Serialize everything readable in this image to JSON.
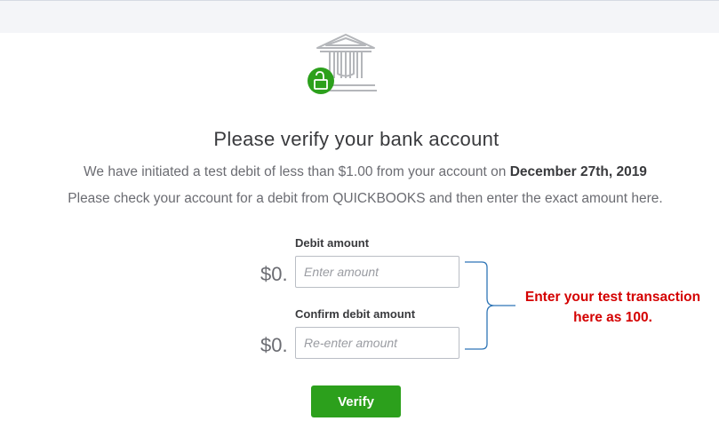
{
  "header": {
    "title": "Please verify your bank account",
    "line1_prefix": "We have initiated a test debit of less than $1.00 from your account on",
    "line1_date": "December 27th, 2019",
    "line2": "Please check your account for a debit from QUICKBOOKS and then enter the exact amount here."
  },
  "form": {
    "debit": {
      "label": "Debit amount",
      "prefix": "$0.",
      "value": "",
      "placeholder": "Enter amount"
    },
    "confirm": {
      "label": "Confirm debit amount",
      "prefix": "$0.",
      "value": "",
      "placeholder": "Re-enter amount"
    },
    "verify_label": "Verify"
  },
  "annotation": {
    "line1": "Enter your test transaction",
    "line2": "here as 100."
  },
  "icons": {
    "bank": "bank-building-icon",
    "lock": "unlocked-padlock-icon"
  },
  "colors": {
    "accent_green": "#2ca01c",
    "annotation_red": "#d40000",
    "brace_blue": "#2e75b6"
  }
}
